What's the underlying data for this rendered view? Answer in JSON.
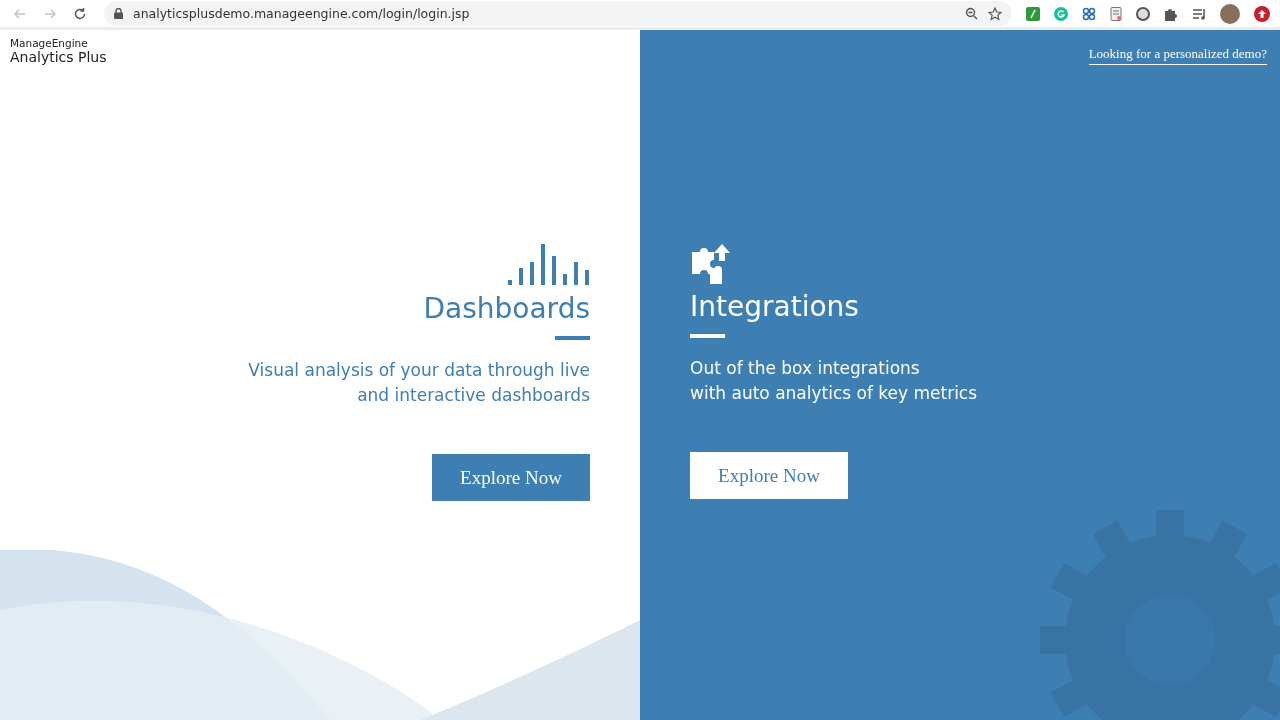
{
  "browser": {
    "url": "analyticsplusdemo.manageengine.com/login/login.jsp"
  },
  "brand": {
    "vendor": "ManageEngine",
    "product": "Analytics Plus"
  },
  "demo_link": "Looking for a personalized demo?",
  "panels": [
    {
      "kind": "light",
      "title": "Dashboards",
      "description": [
        "Visual analysis of your data through live",
        "and interactive dashboards"
      ],
      "button": "Explore Now"
    },
    {
      "kind": "dark",
      "title": "Integrations",
      "description": [
        "Out of the box integrations",
        "with auto analytics of key metrics"
      ],
      "button": "Explore Now"
    }
  ]
}
